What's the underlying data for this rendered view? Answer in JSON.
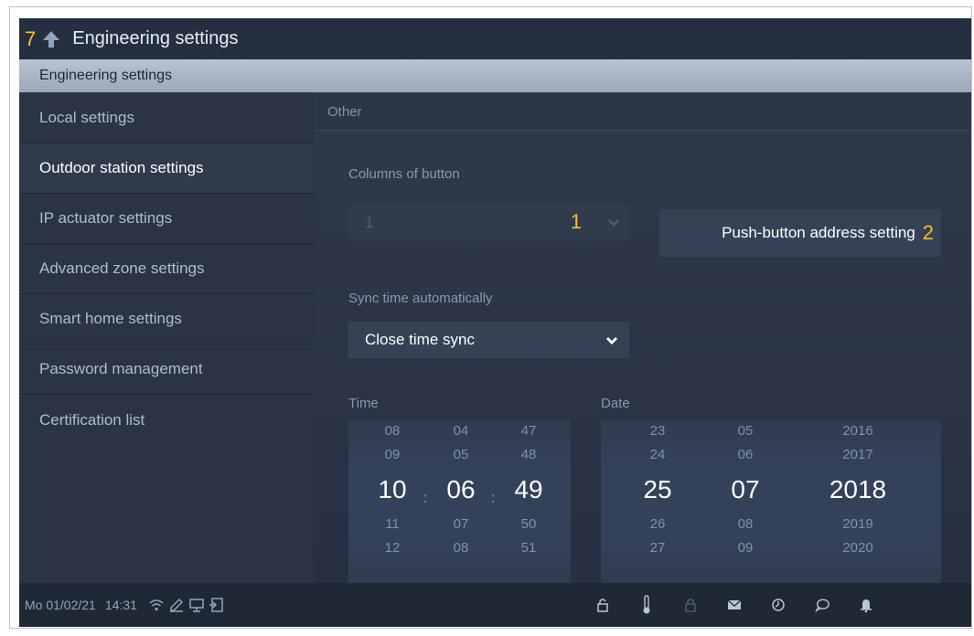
{
  "titlebar": {
    "callout": "7",
    "title": "Engineering settings"
  },
  "section": {
    "label": "Engineering settings"
  },
  "sidebar": {
    "items": [
      {
        "label": "Local settings"
      },
      {
        "label": "Outdoor station settings"
      },
      {
        "label": "IP actuator settings"
      },
      {
        "label": "Advanced zone settings"
      },
      {
        "label": "Smart home settings"
      },
      {
        "label": "Password management"
      },
      {
        "label": "Certification list"
      }
    ]
  },
  "content": {
    "header": "Other",
    "columns": {
      "label": "Columns of button",
      "value": "1",
      "callout": "1"
    },
    "push_button": {
      "label": "Push-button address setting",
      "callout": "2"
    },
    "sync": {
      "label": "Sync time automatically",
      "value": "Close time sync"
    },
    "time": {
      "label": "Time",
      "hours": [
        "08",
        "09",
        "10",
        "11",
        "12"
      ],
      "minutes": [
        "04",
        "05",
        "06",
        "07",
        "08"
      ],
      "seconds": [
        "47",
        "48",
        "49",
        "50",
        "51"
      ],
      "separator": ":"
    },
    "date": {
      "label": "Date",
      "days": [
        "23",
        "24",
        "25",
        "26",
        "27"
      ],
      "months": [
        "05",
        "06",
        "07",
        "08",
        "09"
      ],
      "years": [
        "2016",
        "2017",
        "2018",
        "2019",
        "2020"
      ]
    }
  },
  "statusbar": {
    "date": "Mo 01/02/21",
    "time": "14:31",
    "left_icons": [
      "wifi-icon",
      "edit-icon",
      "monitor-icon",
      "door-icon"
    ],
    "right_icons": [
      "lock-icon",
      "thermometer-icon",
      "lock-disabled-icon",
      "mail-icon",
      "history-icon",
      "chat-icon",
      "bell-icon"
    ]
  },
  "colors": {
    "accent_callout": "#f2c033",
    "background": "#2b3545"
  }
}
